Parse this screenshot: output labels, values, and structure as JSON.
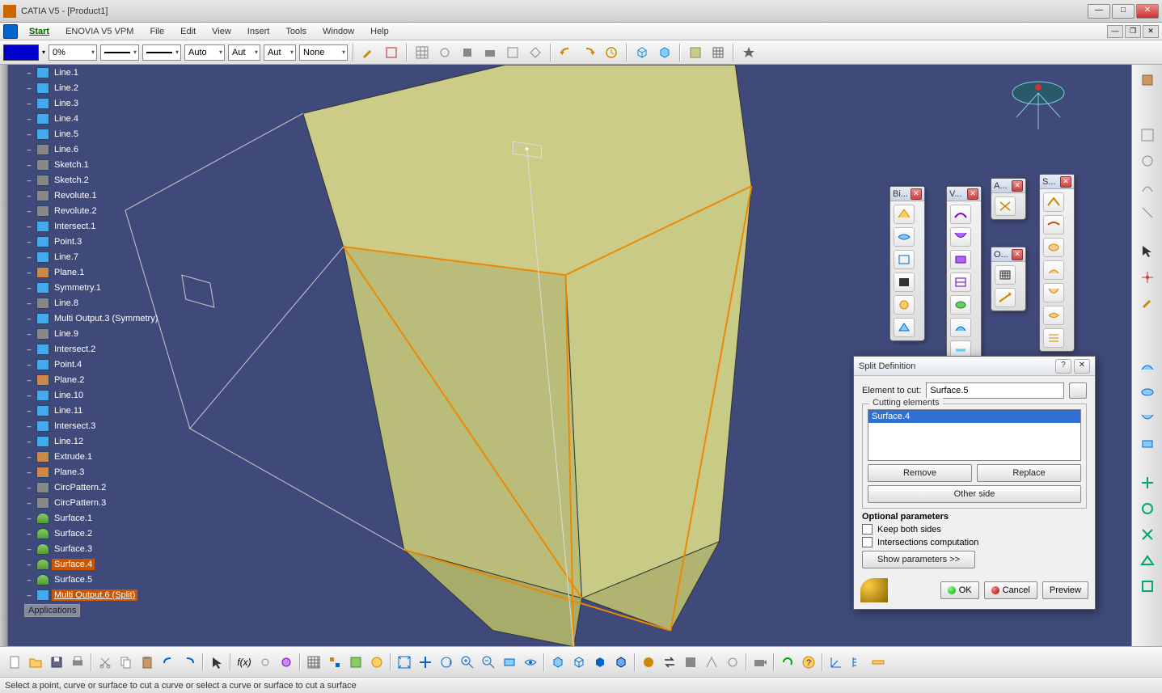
{
  "window": {
    "title": "CATIA V5 - [Product1]"
  },
  "menu": {
    "start": "Start",
    "items": [
      "ENOVIA V5 VPM",
      "File",
      "Edit",
      "View",
      "Insert",
      "Tools",
      "Window",
      "Help"
    ]
  },
  "fmt": {
    "opacity": "0%",
    "auto1": "Auto",
    "auto2": "Aut",
    "auto3": "Aut",
    "none": "None"
  },
  "tree": {
    "items": [
      {
        "lbl": "Line.1",
        "cls": "pt"
      },
      {
        "lbl": "Line.2",
        "cls": "pt"
      },
      {
        "lbl": "Line.3",
        "cls": "pt"
      },
      {
        "lbl": "Line.4",
        "cls": "pt"
      },
      {
        "lbl": "Line.5",
        "cls": "pt"
      },
      {
        "lbl": "Line.6",
        "cls": "sk"
      },
      {
        "lbl": "Sketch.1",
        "cls": "sk"
      },
      {
        "lbl": "Sketch.2",
        "cls": "sk"
      },
      {
        "lbl": "Revolute.1",
        "cls": "sk"
      },
      {
        "lbl": "Revolute.2",
        "cls": "sk"
      },
      {
        "lbl": "Intersect.1",
        "cls": "pt"
      },
      {
        "lbl": "Point.3",
        "cls": "pt"
      },
      {
        "lbl": "Line.7",
        "cls": "pt"
      },
      {
        "lbl": "Plane.1",
        "cls": "pl"
      },
      {
        "lbl": "Symmetry.1",
        "cls": "pt"
      },
      {
        "lbl": "Line.8",
        "cls": "sk"
      },
      {
        "lbl": "Multi Output.3 (Symmetry)",
        "cls": "pt"
      },
      {
        "lbl": "Line.9",
        "cls": "sk"
      },
      {
        "lbl": "Intersect.2",
        "cls": "pt"
      },
      {
        "lbl": "Point.4",
        "cls": "pt"
      },
      {
        "lbl": "Plane.2",
        "cls": "pl"
      },
      {
        "lbl": "Line.10",
        "cls": "pt"
      },
      {
        "lbl": "Line.11",
        "cls": "pt"
      },
      {
        "lbl": "Intersect.3",
        "cls": "pt"
      },
      {
        "lbl": "Line.12",
        "cls": "pt"
      },
      {
        "lbl": "Extrude.1",
        "cls": "pl"
      },
      {
        "lbl": "Plane.3",
        "cls": "pl"
      },
      {
        "lbl": "CircPattern.2",
        "cls": "sk"
      },
      {
        "lbl": "CircPattern.3",
        "cls": "sk"
      },
      {
        "lbl": "Surface.1",
        "cls": "sf"
      },
      {
        "lbl": "Surface.2",
        "cls": "sf"
      },
      {
        "lbl": "Surface.3",
        "cls": "sf"
      },
      {
        "lbl": "Surface.4",
        "cls": "sf",
        "hl": true
      },
      {
        "lbl": "Surface.5",
        "cls": "sf"
      },
      {
        "lbl": "Multi Output.6 (Split)",
        "cls": "pt",
        "hl2": true
      }
    ],
    "applications": "Applications"
  },
  "palettes": {
    "p1": {
      "title": "Bi..."
    },
    "p2": {
      "title": "V..."
    },
    "p3": {
      "title": "A..."
    },
    "p4": {
      "title": "S..."
    },
    "p5": {
      "title": "O..."
    }
  },
  "dialog": {
    "title": "Split Definition",
    "element_label": "Element to cut:",
    "element_value": "Surface.5",
    "group": "Cutting elements",
    "list_item": "Surface.4",
    "remove": "Remove",
    "replace": "Replace",
    "other_side": "Other side",
    "optional": "Optional parameters",
    "keep_both": "Keep both sides",
    "intersections": "Intersections computation",
    "show_params": "Show parameters >>",
    "ok": "OK",
    "cancel": "Cancel",
    "preview": "Preview"
  },
  "status": "Select a point, curve or surface to cut a curve or select a curve or surface to cut a surface"
}
